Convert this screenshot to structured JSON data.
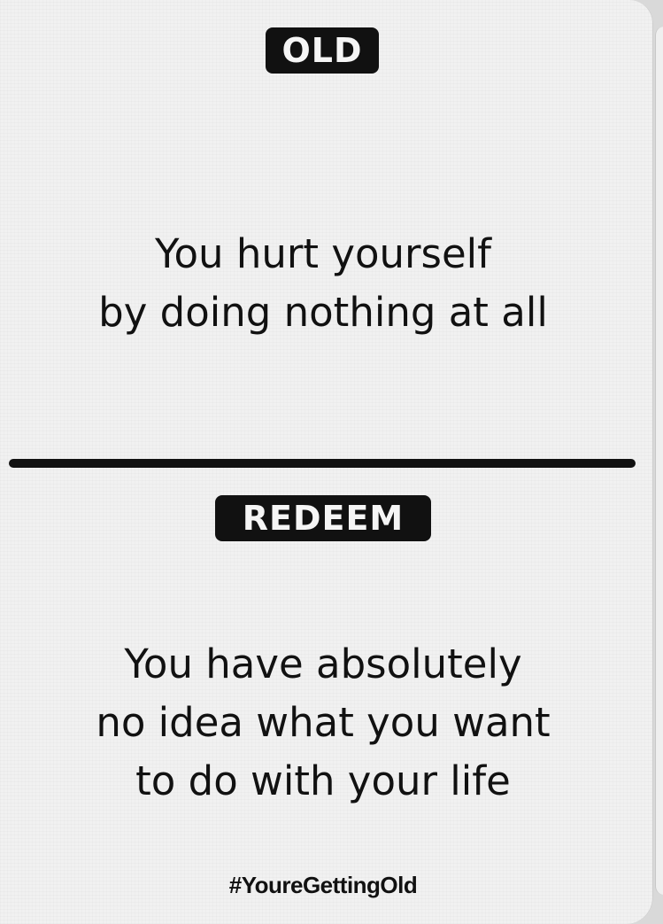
{
  "card": {
    "old_label": "OLD",
    "old_text": [
      "You hurt yourself",
      "by doing nothing at all"
    ],
    "redeem_label": "REDEEM",
    "redeem_text": [
      "You have absolutely",
      "no idea what you want",
      "to do with your life"
    ],
    "hashtag": "#YoureGettingOld"
  },
  "colors": {
    "card_background": "#f1f1f1",
    "ink": "#111111"
  }
}
